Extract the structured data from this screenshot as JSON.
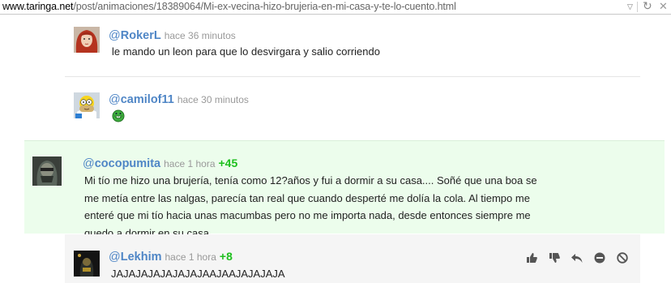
{
  "browser": {
    "url_domain": "www.taringa.net",
    "url_path": "/post/animaciones/18389064/Mi-ex-vecina-hizo-brujeria-en-mi-casa-y-te-lo-cuento.html",
    "dropdown_icon": "▽",
    "reload_icon": "↻",
    "stop_icon": "✕"
  },
  "comments": [
    {
      "at": "@",
      "user": "RokerL",
      "time": "hace 36 minutos",
      "votes": "",
      "text": "le mando un leon para que lo desvirgara y salio corriendo",
      "avatar": "red-hair-girl-avatar"
    },
    {
      "at": "@",
      "user": "camilof11",
      "time": "hace 30 minutos",
      "votes": "",
      "text": "",
      "emoji": "green-grin-emoticon",
      "avatar": "homer-simpson-avatar"
    },
    {
      "at": "@",
      "user": "cocopumita",
      "time": "hace 1 hora",
      "votes": "+45",
      "text": "Mi tío me hizo una brujería, tenía como 12?años y fui a dormir a su casa.... Soñé que una boa se me metía entre las nalgas, parecía tan real que cuando desperté me dolía la cola. Al tiempo me enteré que mi tío hacia unas macumbas pero no me importa nada, desde entonces siempre me quedo a dormir en su casa",
      "avatar": "masked-warrior-avatar",
      "highlight_color": "#ecfdec"
    },
    {
      "at": "@",
      "user": "Lekhim",
      "time": "hace 1 hora",
      "votes": "+8",
      "text": "JAJAJAJAJAJAJAJAAJAAJAJAJAJA",
      "avatar": "dark-character-avatar"
    }
  ],
  "actions": [
    "thumbs-up-icon",
    "thumbs-down-icon",
    "reply-icon",
    "hide-icon",
    "block-icon"
  ],
  "colors": {
    "username": "#4f86c6",
    "votes": "#1dbf1d",
    "time": "#999999",
    "text": "#222222"
  }
}
